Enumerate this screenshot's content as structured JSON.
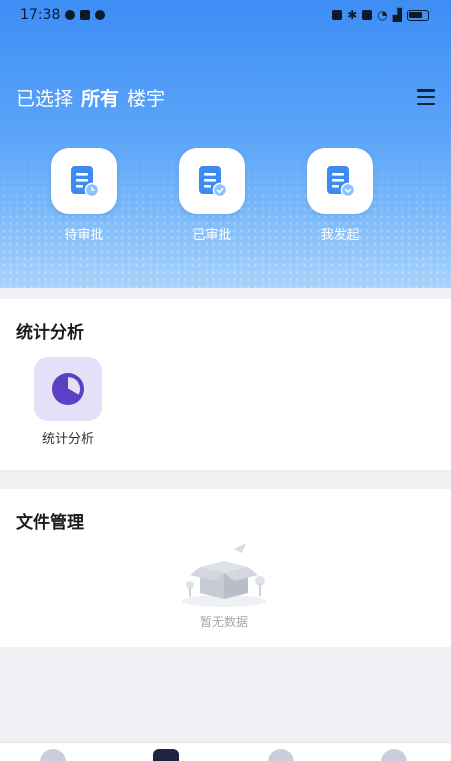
{
  "status_bar": {
    "time": "17:38",
    "indicators": [
      "nfc-icon",
      "bluetooth-icon",
      "vibrate-icon",
      "wifi-icon",
      "signal-icon",
      "battery-icon"
    ]
  },
  "header": {
    "prefix": "已选择",
    "scope": "所有",
    "suffix": "楼宇"
  },
  "quick_actions": [
    {
      "label": "待审批",
      "icon": "pending-doc-icon"
    },
    {
      "label": "已审批",
      "icon": "approved-doc-icon"
    },
    {
      "label": "我发起",
      "icon": "initiated-doc-icon"
    }
  ],
  "stats_section": {
    "title": "统计分析",
    "items": [
      {
        "label": "统计分析",
        "icon": "pie-chart-icon"
      }
    ]
  },
  "files_section": {
    "title": "文件管理",
    "empty_text": "暂无数据"
  },
  "colors": {
    "header_top": "#3d8df5",
    "header_bottom": "#a9d3fb",
    "stat_icon_bg": "#e3e0f7",
    "stat_icon_fg": "#5b3fc4",
    "doc_icon": "#3c8cf0"
  }
}
